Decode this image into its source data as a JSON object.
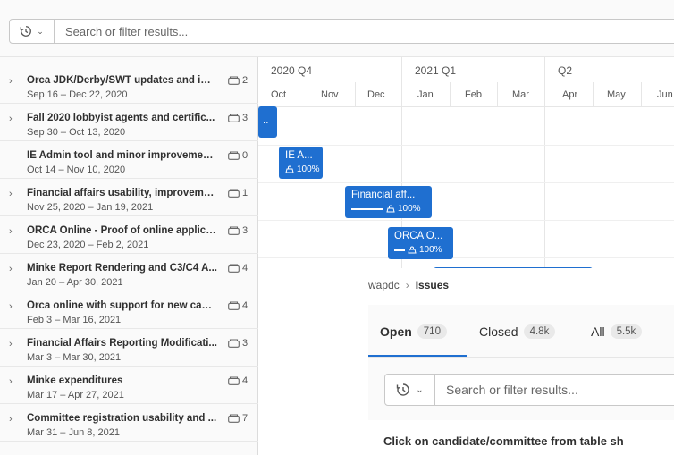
{
  "filter_bar": {
    "placeholder": "Search or filter results...",
    "history_icon": "history-icon",
    "dropdown_icon": "chevron-down-icon"
  },
  "epics": [
    {
      "title": "Orca JDK/Derby/SWT updates and im...",
      "dates": "Sep 16 – Dec 22, 2020",
      "count": "2",
      "expandable": true
    },
    {
      "title": "Fall 2020 lobbyist agents and certific...",
      "dates": "Sep 30 – Oct 13, 2020",
      "count": "3",
      "expandable": true
    },
    {
      "title": "IE Admin tool and minor improvements",
      "dates": "Oct 14 – Nov 10, 2020",
      "count": "0",
      "expandable": false
    },
    {
      "title": "Financial affairs usability, improveme...",
      "dates": "Nov 25, 2020 – Jan 19, 2021",
      "count": "1",
      "expandable": true
    },
    {
      "title": "ORCA Online - Proof of online applica...",
      "dates": "Dec 23, 2020 – Feb 2, 2021",
      "count": "3",
      "expandable": true
    },
    {
      "title": "Minke Report Rendering and C3/C4 A...",
      "dates": "Jan 20 – Apr 30, 2021",
      "count": "4",
      "expandable": true
    },
    {
      "title": "Orca online with support for new cam...",
      "dates": "Feb 3 – Mar 16, 2021",
      "count": "4",
      "expandable": true
    },
    {
      "title": "Financial Affairs Reporting Modificati...",
      "dates": "Mar 3 – Mar 30, 2021",
      "count": "3",
      "expandable": true
    },
    {
      "title": "Minke expenditures",
      "dates": "Mar 17 – Apr 27, 2021",
      "count": "4",
      "expandable": true
    },
    {
      "title": "Committee registration usability and ...",
      "dates": "Mar 31 – Jun 8, 2021",
      "count": "7",
      "expandable": true
    }
  ],
  "timeline": {
    "quarters": [
      "2020 Q4",
      "2021 Q1",
      "Q2"
    ],
    "months": [
      "Oct",
      "Nov",
      "Dec",
      "Jan",
      "Feb",
      "Mar",
      "Apr",
      "May",
      "Jun"
    ],
    "bars": [
      {
        "title": "..",
        "progress": ""
      },
      {
        "title": "IE A...",
        "progress": "100%"
      },
      {
        "title": "Financial aff...",
        "progress": "100%"
      },
      {
        "title": "ORCA O...",
        "progress": "100%"
      },
      {
        "title": "",
        "progress": ""
      }
    ]
  },
  "issues_panel": {
    "breadcrumb": {
      "project": "wapdc",
      "current": "Issues"
    },
    "tabs": [
      {
        "label": "Open",
        "count": "710"
      },
      {
        "label": "Closed",
        "count": "4.8k"
      },
      {
        "label": "All",
        "count": "5.5k"
      }
    ],
    "search_placeholder": "Search or filter results...",
    "notice": "Click on candidate/committee from table sh"
  },
  "colors": {
    "accent": "#1f6fd0",
    "background": "#fafafa"
  }
}
